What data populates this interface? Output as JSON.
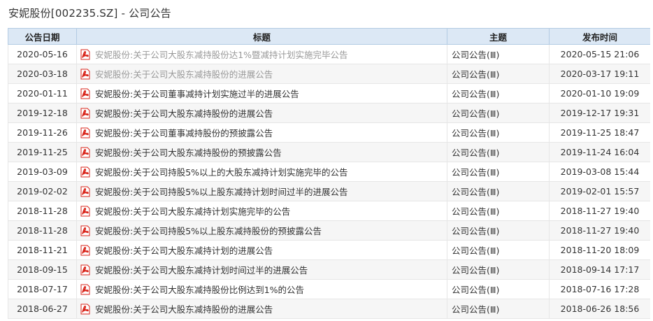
{
  "page": {
    "title": "安妮股份[002235.SZ] - 公司公告"
  },
  "table": {
    "headers": {
      "date": "公告日期",
      "title": "标题",
      "topic": "主题",
      "time": "发布时间"
    },
    "rows": [
      {
        "date": "2020-05-16",
        "title": "安妮股份:关于公司大股东减持股份达1%暨减持计划实施完毕公告",
        "topic": "公司公告(Ⅲ)",
        "time": "2020-05-15 21:06",
        "visited": true
      },
      {
        "date": "2020-03-18",
        "title": "安妮股份:关于公司大股东减持股份的进展公告",
        "topic": "公司公告(Ⅲ)",
        "time": "2020-03-17 19:11",
        "visited": true
      },
      {
        "date": "2020-01-11",
        "title": "安妮股份:关于公司董事减持计划实施过半的进展公告",
        "topic": "公司公告(Ⅲ)",
        "time": "2020-01-10 19:09",
        "visited": false
      },
      {
        "date": "2019-12-18",
        "title": "安妮股份:关于公司大股东减持股份的进展公告",
        "topic": "公司公告(Ⅲ)",
        "time": "2019-12-17 19:31",
        "visited": false
      },
      {
        "date": "2019-11-26",
        "title": "安妮股份:关于公司董事减持股份的预披露公告",
        "topic": "公司公告(Ⅲ)",
        "time": "2019-11-25 18:47",
        "visited": false
      },
      {
        "date": "2019-11-25",
        "title": "安妮股份:关于公司大股东减持股份的预披露公告",
        "topic": "公司公告(Ⅲ)",
        "time": "2019-11-24 16:04",
        "visited": false
      },
      {
        "date": "2019-03-09",
        "title": "安妮股份:关于公司持股5%以上的大股东减持计划实施完毕的公告",
        "topic": "公司公告(Ⅲ)",
        "time": "2019-03-08 15:44",
        "visited": false
      },
      {
        "date": "2019-02-02",
        "title": "安妮股份:关于公司持股5%以上股东减持计划时间过半的进展公告",
        "topic": "公司公告(Ⅲ)",
        "time": "2019-02-01 15:57",
        "visited": false
      },
      {
        "date": "2018-11-28",
        "title": "安妮股份:关于公司大股东减持计划实施完毕的公告",
        "topic": "公司公告(Ⅲ)",
        "time": "2018-11-27 19:40",
        "visited": false
      },
      {
        "date": "2018-11-28",
        "title": "安妮股份:关于公司持股5%以上股东减持股份的预披露公告",
        "topic": "公司公告(Ⅲ)",
        "time": "2018-11-27 19:40",
        "visited": false
      },
      {
        "date": "2018-11-21",
        "title": "安妮股份:关于公司大股东减持计划的进展公告",
        "topic": "公司公告(Ⅲ)",
        "time": "2018-11-20 18:09",
        "visited": false
      },
      {
        "date": "2018-09-15",
        "title": "安妮股份:关于公司大股东减持计划时间过半的进展公告",
        "topic": "公司公告(Ⅲ)",
        "time": "2018-09-14 17:17",
        "visited": false
      },
      {
        "date": "2018-07-17",
        "title": "安妮股份:关于公司大股东减持股份比例达到1%的公告",
        "topic": "公司公告(Ⅲ)",
        "time": "2018-07-16 17:28",
        "visited": false
      },
      {
        "date": "2018-06-27",
        "title": "安妮股份:关于公司大股东减持股份的进展公告",
        "topic": "公司公告(Ⅲ)",
        "time": "2018-06-26 18:56",
        "visited": false
      }
    ]
  },
  "icons": {
    "row_icon": "pdf-icon"
  },
  "colors": {
    "header_bg": "#dce8f5",
    "pdf_red": "#d9261c",
    "visited_link": "#999999"
  }
}
